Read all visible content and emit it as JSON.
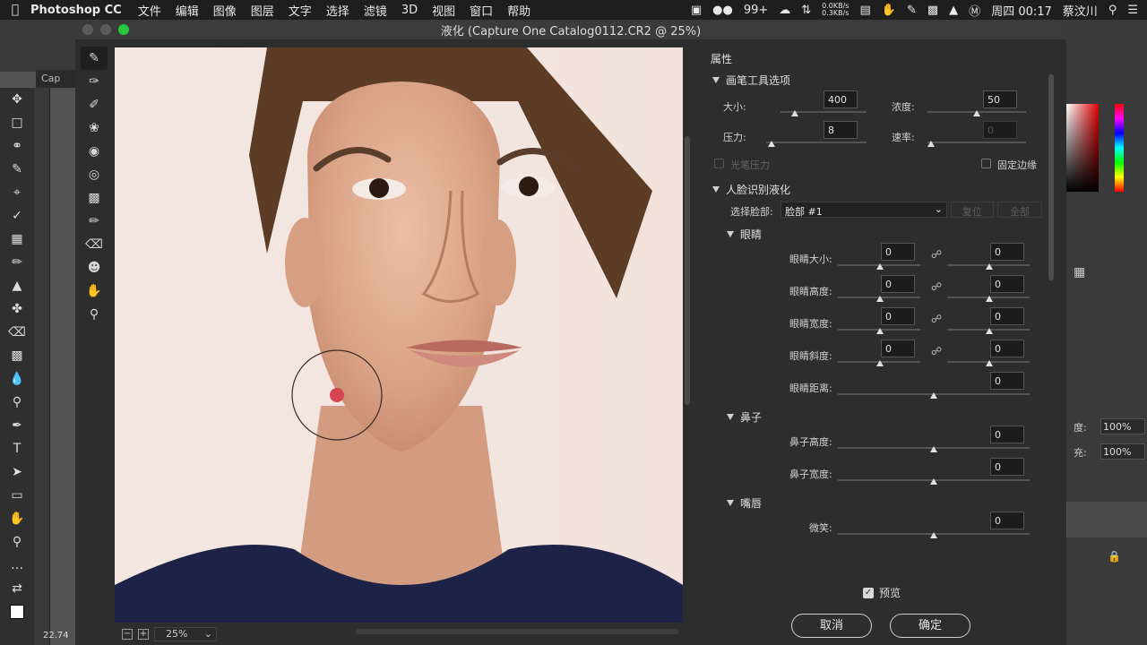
{
  "menubar": {
    "app_name": "Photoshop CC",
    "items": [
      "文件",
      "编辑",
      "图像",
      "图层",
      "文字",
      "选择",
      "滤镜",
      "3D",
      "视图",
      "窗口",
      "帮助"
    ],
    "badge": "99+",
    "net_up": "0.0KB/s",
    "net_down": "0.3KB/s",
    "clock": "周四 00:17",
    "user": "蔡汶川"
  },
  "ps": {
    "tab_label": "Cap",
    "zoom_readout": "22.74",
    "right_labels": {
      "opacity_label": "度:",
      "opacity_value": "100%",
      "fill_label": "充:",
      "fill_value": "100%"
    }
  },
  "dialog": {
    "title": "液化 (Capture One Catalog0112.CR2 @ 25%)",
    "zoom": "25%",
    "panel_title": "属性",
    "brush": {
      "section": "画笔工具选项",
      "size_label": "大小:",
      "size_value": "400",
      "density_label": "浓度:",
      "density_value": "50",
      "pressure_label": "压力:",
      "pressure_value": "8",
      "rate_label": "速率:",
      "rate_value": "0",
      "stylus_label": "光笔压力",
      "pin_edges_label": "固定边缘"
    },
    "face": {
      "section": "人脸识别液化",
      "select_label": "选择脸部:",
      "select_value": "脸部 #1",
      "reset_label": "复位",
      "all_label": "全部",
      "eyes": {
        "section": "眼睛",
        "rows": [
          {
            "label": "眼睛大小:",
            "left": "0",
            "right": "0"
          },
          {
            "label": "眼睛高度:",
            "left": "0",
            "right": "0"
          },
          {
            "label": "眼睛宽度:",
            "left": "0",
            "right": "0"
          },
          {
            "label": "眼睛斜度:",
            "left": "0",
            "right": "0"
          }
        ],
        "distance_label": "眼睛距离:",
        "distance_value": "0"
      },
      "nose": {
        "section": "鼻子",
        "height_label": "鼻子高度:",
        "height_value": "0",
        "width_label": "鼻子宽度:",
        "width_value": "0"
      },
      "mouth": {
        "section": "嘴唇",
        "smile_label": "微笑:",
        "smile_value": "0"
      }
    },
    "preview_label": "预览",
    "cancel_label": "取消",
    "ok_label": "确定"
  },
  "colors": {
    "accent_red": "#d5444f",
    "traffic_close": "#5a5a5a",
    "traffic_zoom": "#28c840"
  }
}
